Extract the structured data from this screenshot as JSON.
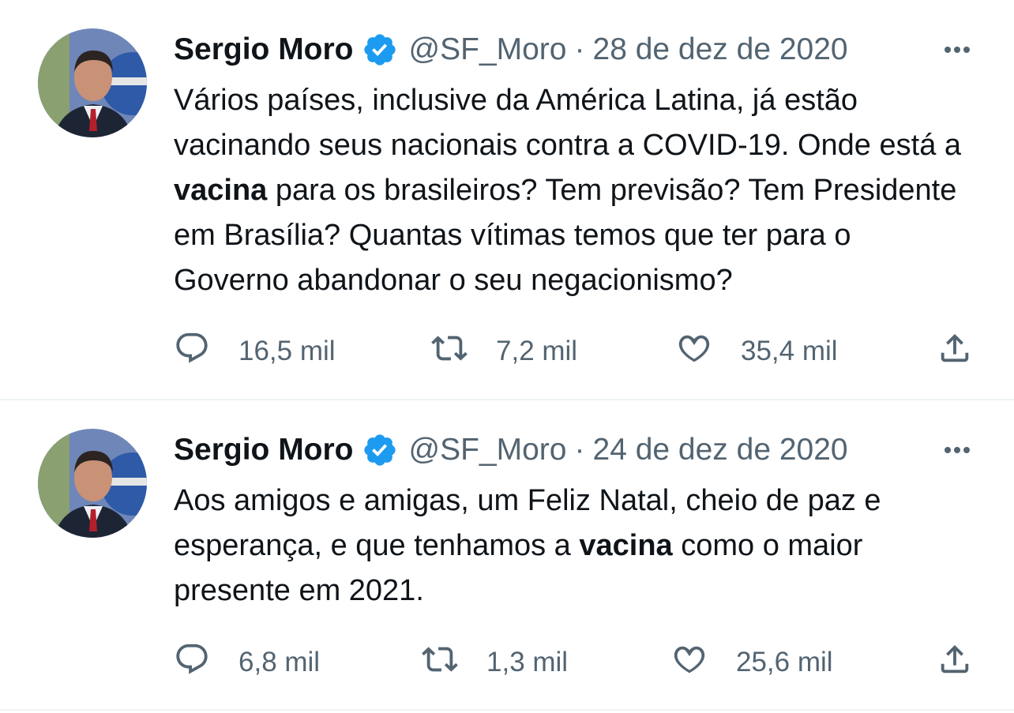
{
  "tweets": [
    {
      "name": "Sergio Moro",
      "handle": "@SF_Moro",
      "separator": "·",
      "date": "28 de dez de 2020",
      "text_parts": [
        "Vários países, inclusive da América Latina, já estão vacinando seus nacionais contra a COVID-19. Onde está a ",
        "vacina",
        " para os brasileiros? Tem previsão? Tem Presidente em Brasília? Quantas vítimas temos que ter para o Governo abandonar o seu negacionismo?"
      ],
      "replies": "16,5 mil",
      "retweets": "7,2 mil",
      "likes": "35,4 mil"
    },
    {
      "name": "Sergio Moro",
      "handle": "@SF_Moro",
      "separator": "·",
      "date": "24 de dez de 2020",
      "text_parts": [
        "Aos amigos e amigas, um Feliz Natal, cheio de paz e esperança, e que tenhamos a ",
        "vacina",
        " como o maior presente em 2021."
      ],
      "replies": "6,8 mil",
      "retweets": "1,3 mil",
      "likes": "25,6 mil"
    }
  ],
  "icons": {
    "verified": "verified-badge-icon",
    "more": "more-options-icon",
    "reply": "reply-icon",
    "retweet": "retweet-icon",
    "like": "like-icon",
    "share": "share-icon"
  },
  "colors": {
    "text": "#0f1419",
    "secondary": "#536471",
    "verified": "#1d9bf0",
    "divider": "#eff3f4"
  }
}
